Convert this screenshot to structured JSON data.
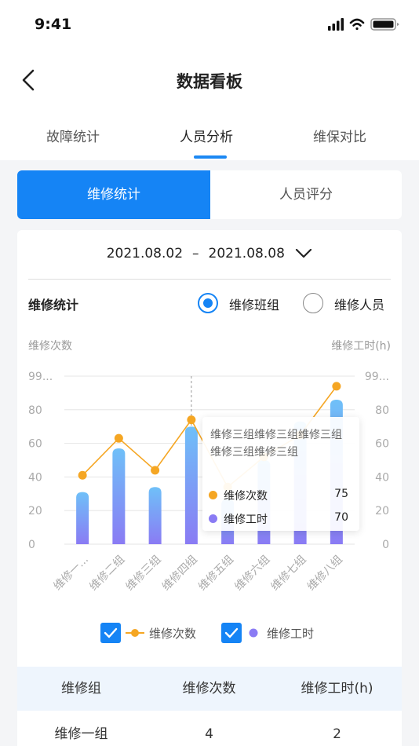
{
  "status_bar": {
    "time": "9:41"
  },
  "nav": {
    "title": "数据看板"
  },
  "tabs": [
    {
      "label": "故障统计",
      "active": false
    },
    {
      "label": "人员分析",
      "active": true
    },
    {
      "label": "维保对比",
      "active": false
    }
  ],
  "segment": {
    "options": [
      "维修统计",
      "人员评分"
    ],
    "selected": "维修统计"
  },
  "date_range": {
    "start": "2021.08.02",
    "separator": "–",
    "end": "2021.08.08"
  },
  "section": {
    "title": "维修统计",
    "radios": [
      {
        "label": "维修班组",
        "selected": true
      },
      {
        "label": "维修人员",
        "selected": false
      }
    ]
  },
  "chart_data": {
    "type": "bar",
    "ylabel": "维修次数",
    "ylabel_right": "维修工时(h)",
    "y_ticks": [
      "0",
      "20",
      "40",
      "60",
      "80",
      "99..."
    ],
    "y_ticks_right": [
      "0",
      "20",
      "40",
      "60",
      "80",
      "99..."
    ],
    "ylim": [
      0,
      100
    ],
    "categories": [
      "维修一...",
      "维修二组",
      "维修三组",
      "维修四组",
      "维修五组",
      "维修六组",
      "维修七组",
      "维修八组"
    ],
    "series": [
      {
        "name": "维修次数",
        "type": "line",
        "color": "#f5a623",
        "values": [
          41,
          63,
          44,
          74,
          34,
          52,
          65,
          94
        ]
      },
      {
        "name": "维修工时",
        "type": "bar",
        "color": "#8a7bf4",
        "color_top": "#6fc0f8",
        "values": [
          31,
          57,
          34,
          70,
          27,
          50,
          73,
          86
        ]
      }
    ],
    "highlight_index": 3,
    "legend": {
      "position": "bottom",
      "entries": [
        "维修次数",
        "维修工时"
      ]
    },
    "tooltip": {
      "title": "维修三组维修三组维修三组维修三组维修三组",
      "rows": [
        {
          "name": "维修次数",
          "value": "75",
          "color": "#f5a623"
        },
        {
          "name": "维修工时",
          "value": "70",
          "color": "#8a7bf4"
        }
      ]
    }
  },
  "table": {
    "headers": [
      "维修组",
      "维修次数",
      "维修工时(h)"
    ],
    "rows": [
      [
        "维修一组",
        "4",
        "2"
      ]
    ]
  }
}
